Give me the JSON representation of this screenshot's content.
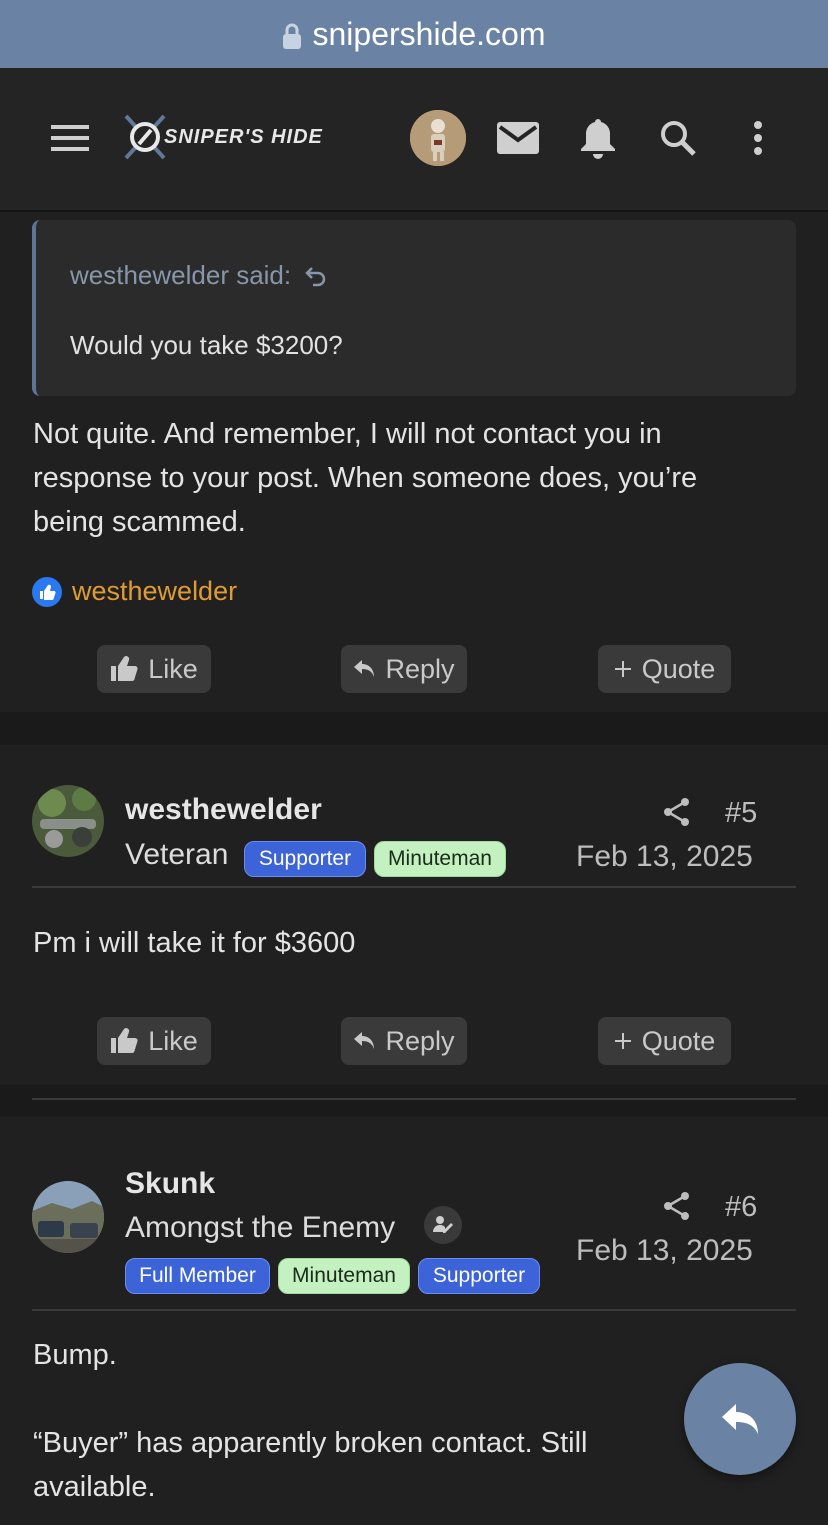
{
  "browser": {
    "url": "snipershide.com"
  },
  "site": {
    "logo_text": "SNIPER'S HIDE"
  },
  "post4": {
    "quote_attribution": "westhewelder said:",
    "quote_text": "Would you take $3200?",
    "body_line1": "Not quite. And remember, I will not contact you in",
    "body_line2": "response to your post. When someone does, you’re",
    "body_line3": "being scammed.",
    "reaction_user": "westhewelder"
  },
  "post5": {
    "username": "westhewelder",
    "user_title": "Veteran",
    "badges": [
      "Supporter",
      "Minuteman"
    ],
    "number": "#5",
    "date": "Feb 13, 2025",
    "body": "Pm i will take it for $3600"
  },
  "post6": {
    "username": "Skunk",
    "user_title": "Amongst the Enemy",
    "badges": [
      "Full Member",
      "Minuteman",
      "Supporter"
    ],
    "number": "#6",
    "date": "Feb 13, 2025",
    "body_line1": "Bump.",
    "body_line2": "“Buyer” has apparently broken contact. Still",
    "body_line3": "available."
  },
  "actions": {
    "like": "Like",
    "reply": "Reply",
    "quote": "Quote"
  },
  "colors": {
    "accent": "#6a83a4",
    "header_bg": "#242424",
    "card_bg": "#202020",
    "reaction_user": "#e09b33",
    "badge_blue": "#3d63d8",
    "badge_green": "#c3f2c0"
  },
  "icons": [
    "lock-icon",
    "menu-icon",
    "logo-icon",
    "avatar",
    "mail-icon",
    "bell-icon",
    "search-icon",
    "more-vertical-icon",
    "reply-arrow-icon",
    "like-thumb-icon",
    "share-icon",
    "plus-icon",
    "edit-user-icon"
  ]
}
